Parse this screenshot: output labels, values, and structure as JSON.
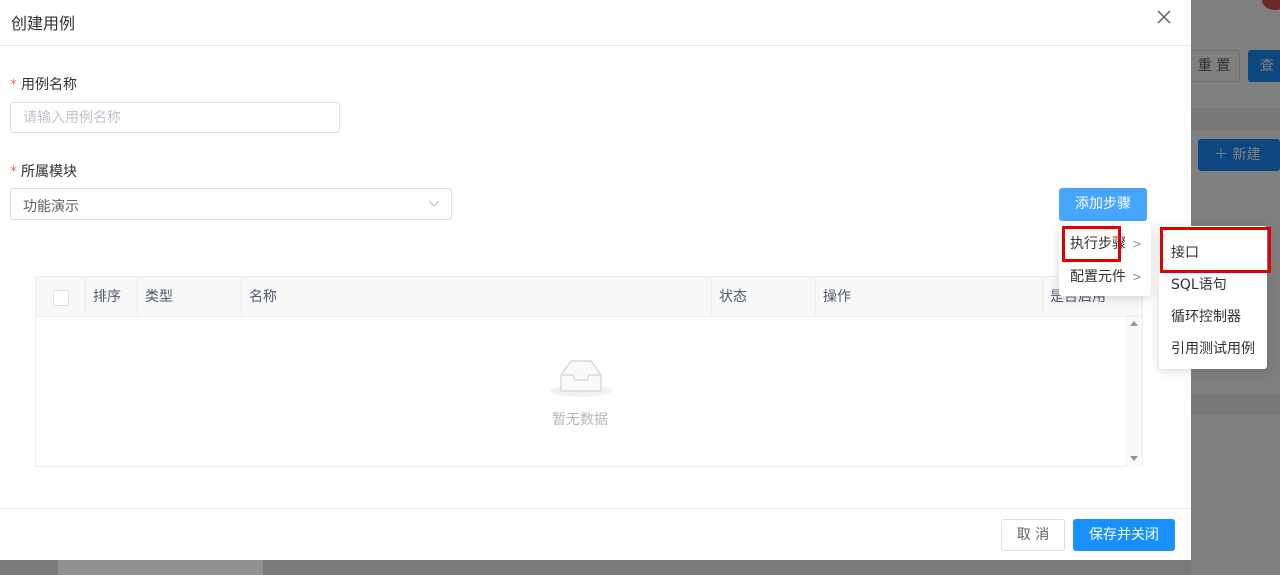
{
  "background": {
    "reset_label": "重 置",
    "query_label": "查",
    "new_label": "＋ 新建"
  },
  "dialog": {
    "title": "创建用例",
    "close_icon": "close-icon"
  },
  "form": {
    "name_label": "用例名称",
    "name_placeholder": "请输入用例名称",
    "module_label": "所属模块",
    "module_value": "功能演示",
    "required_mark": "*"
  },
  "add_step_label": "添加步骤",
  "table": {
    "columns": [
      "排序",
      "类型",
      "名称",
      "状态",
      "操作",
      "是否启用"
    ],
    "empty_text": "暂无数据"
  },
  "step_menu": {
    "items": [
      {
        "label": "执行步骤",
        "arrow": ">"
      },
      {
        "label": "配置元件",
        "arrow": ">"
      }
    ]
  },
  "sub_menu": {
    "items": [
      {
        "label": "接口"
      },
      {
        "label": "SQL语句"
      },
      {
        "label": "循环控制器"
      },
      {
        "label": "引用测试用例"
      }
    ]
  },
  "footer": {
    "cancel_label": "取 消",
    "save_label": "保存并关闭"
  },
  "colors": {
    "primary": "#1890ff",
    "highlight": "#e00000",
    "required": "#f56c6c"
  }
}
